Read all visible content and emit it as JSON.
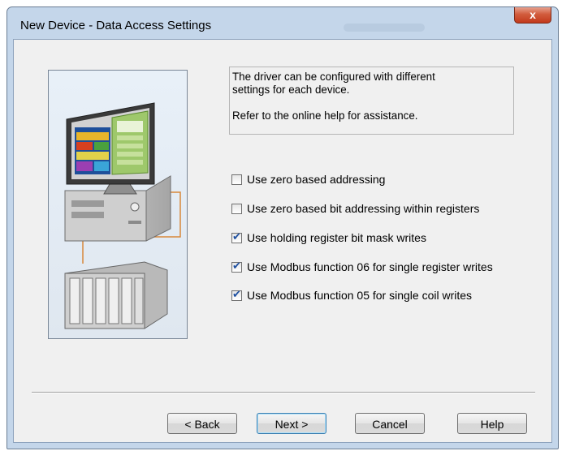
{
  "window": {
    "title": "New Device - Data Access Settings",
    "close_glyph": "x"
  },
  "info": {
    "line1": "The driver can be configured with different",
    "line2": "settings for each device.",
    "line3": "Refer to the online help for assistance."
  },
  "options": [
    {
      "label": "Use zero based addressing",
      "checked": false
    },
    {
      "label": "Use zero based bit addressing within registers",
      "checked": false
    },
    {
      "label": "Use holding register bit mask writes",
      "checked": true
    },
    {
      "label": "Use Modbus function 06 for single register writes",
      "checked": true
    },
    {
      "label": "Use Modbus function 05 for single coil writes",
      "checked": true
    }
  ],
  "buttons": {
    "back": "< Back",
    "next": "Next >",
    "cancel": "Cancel",
    "help": "Help"
  },
  "icons": {
    "close": "close-icon",
    "illustration": "computer-plc-illustration",
    "check": "checkmark-icon"
  },
  "colors": {
    "title_bar": "#c4d6ea",
    "close_button": "#c2391c",
    "client_bg": "#f0f0f0",
    "check": "#1d4fa0"
  }
}
